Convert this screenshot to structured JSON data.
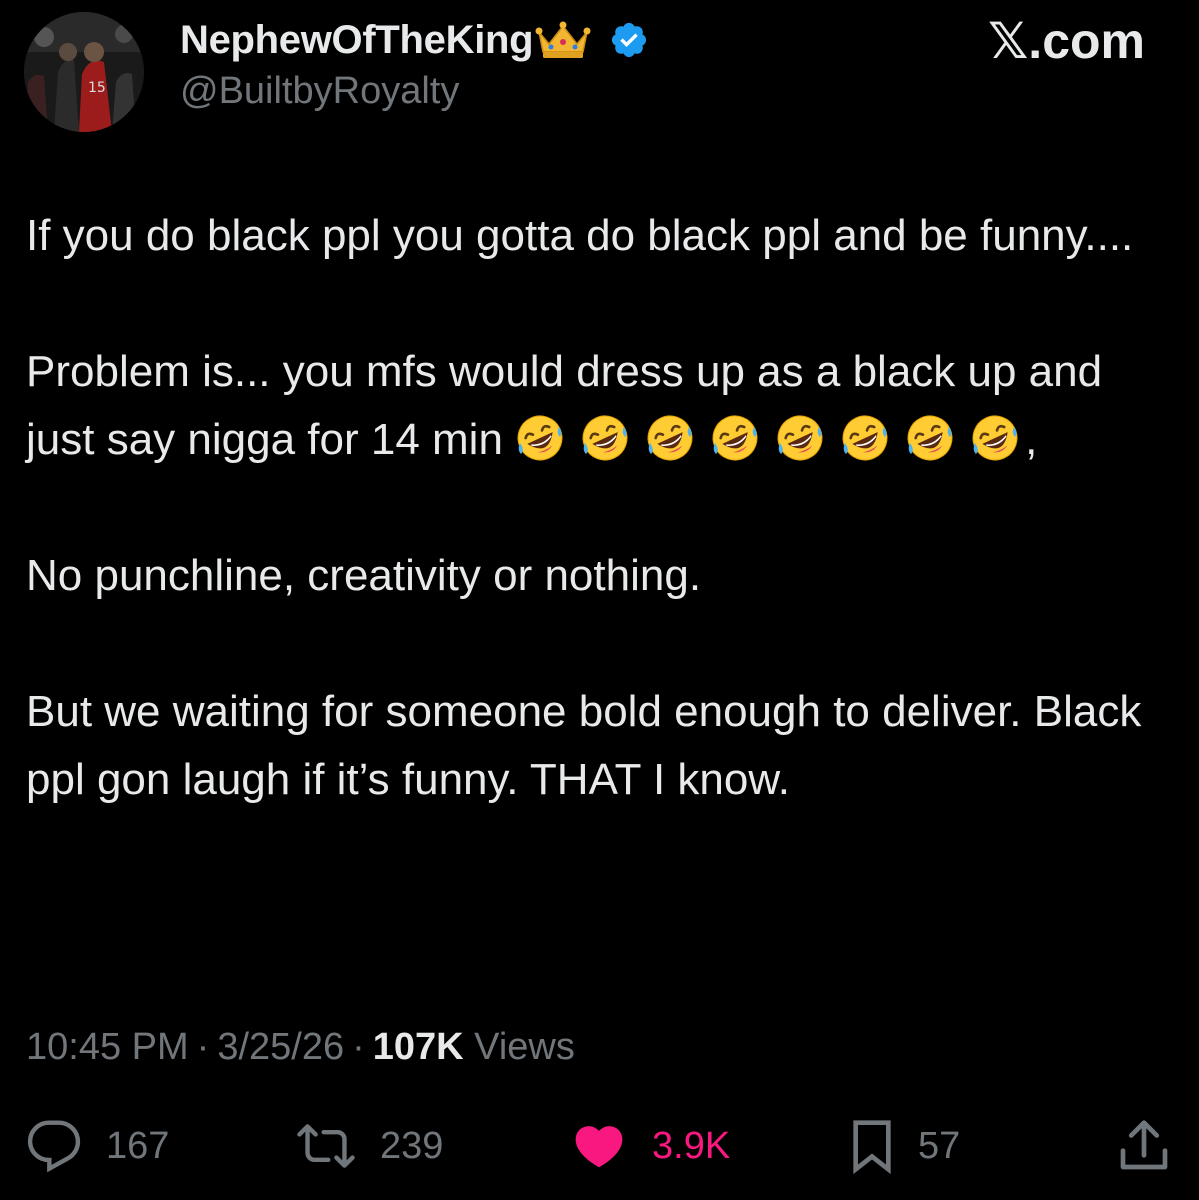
{
  "author": {
    "display_name": "NephewOfTheKing",
    "handle": "@BuiltbyRoyalty",
    "verified": true,
    "name_emoji": "crown-icon"
  },
  "site_label": "𝕏.com",
  "tweet": {
    "paragraphs": [
      "If you do black ppl you gotta do black ppl and be funny....",
      "Problem is... you mfs would dress up as a black up and just say nigga for 14 min",
      "No punchline, creativity or nothing.",
      "But we waiting for someone bold enough to deliver. Black ppl gon laugh if it’s funny. THAT I know."
    ],
    "emoji_run_name": "rolling-on-floor-laughing",
    "emoji_run_count": 8,
    "emoji_run_trailing": ","
  },
  "meta": {
    "time": "10:45 PM",
    "separator": "·",
    "date": "3/25/26",
    "views_count": "107K",
    "views_label": "Views"
  },
  "actions": {
    "replies": "167",
    "reposts": "239",
    "likes": "3.9K",
    "bookmarks": "57"
  },
  "colors": {
    "background": "#000000",
    "primary_text": "#e7e9ea",
    "secondary_text": "#71767b",
    "like_active": "#f91880",
    "verified_badge": "#1d9bf0"
  }
}
